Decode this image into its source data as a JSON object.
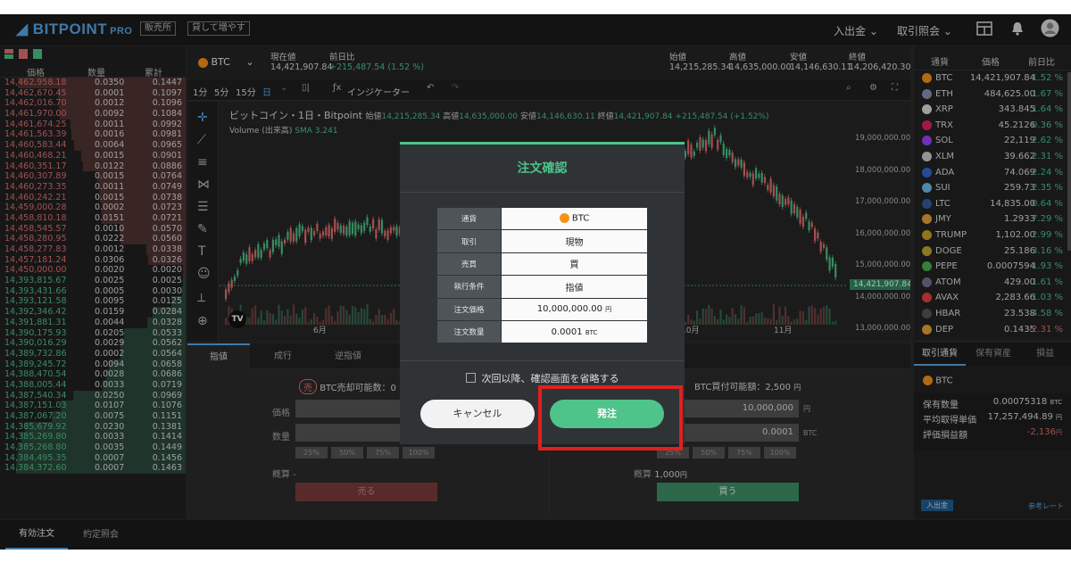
{
  "header": {
    "brand": "BITPOINT",
    "brand_suffix": "PRO",
    "tag1": "販売所",
    "tag2": "貸して増やす",
    "menu1": "入出金",
    "menu2": "取引照会"
  },
  "orderbook": {
    "col_price": "価格",
    "col_qty": "数量",
    "col_total": "累計",
    "asks": [
      [
        "14,462,958.18",
        "0.0350",
        "0.1447"
      ],
      [
        "14,462,670.45",
        "0.0001",
        "0.1097"
      ],
      [
        "14,462,016.70",
        "0.0012",
        "0.1096"
      ],
      [
        "14,461,970.00",
        "0.0092",
        "0.1084"
      ],
      [
        "14,461,674.25",
        "0.0011",
        "0.0992"
      ],
      [
        "14,461,563.39",
        "0.0016",
        "0.0981"
      ],
      [
        "14,460,583.44",
        "0.0064",
        "0.0965"
      ],
      [
        "14,460,468.21",
        "0.0015",
        "0.0901"
      ],
      [
        "14,460,351.17",
        "0.0122",
        "0.0886"
      ],
      [
        "14,460,307.89",
        "0.0015",
        "0.0764"
      ],
      [
        "14,460,273.35",
        "0.0011",
        "0.0749"
      ],
      [
        "14,460,242.21",
        "0.0015",
        "0.0738"
      ],
      [
        "14,459,000.28",
        "0.0002",
        "0.0723"
      ],
      [
        "14,458,810.18",
        "0.0151",
        "0.0721"
      ],
      [
        "14,458,545.57",
        "0.0010",
        "0.0570"
      ],
      [
        "14,458,280.95",
        "0.0222",
        "0.0560"
      ],
      [
        "14,458,277.83",
        "0.0012",
        "0.0338"
      ],
      [
        "14,457,181.24",
        "0.0306",
        "0.0326"
      ],
      [
        "14,450,000.00",
        "0.0020",
        "0.0020"
      ]
    ],
    "bids": [
      [
        "14,393,815.67",
        "0.0025",
        "0.0025"
      ],
      [
        "14,393,431.66",
        "0.0005",
        "0.0030"
      ],
      [
        "14,393,121.58",
        "0.0095",
        "0.0125"
      ],
      [
        "14,392,346.42",
        "0.0159",
        "0.0284"
      ],
      [
        "14,391,881.31",
        "0.0044",
        "0.0328"
      ],
      [
        "14,390,175.93",
        "0.0205",
        "0.0533"
      ],
      [
        "14,390,016.29",
        "0.0029",
        "0.0562"
      ],
      [
        "14,389,732.86",
        "0.0002",
        "0.0564"
      ],
      [
        "14,389,245.72",
        "0.0094",
        "0.0658"
      ],
      [
        "14,388,470.54",
        "0.0028",
        "0.0686"
      ],
      [
        "14,388,005.44",
        "0.0033",
        "0.0719"
      ],
      [
        "14,387,540.34",
        "0.0250",
        "0.0969"
      ],
      [
        "14,387,151.03",
        "0.0107",
        "0.1076"
      ],
      [
        "14,387,067.20",
        "0.0075",
        "0.1151"
      ],
      [
        "14,385,679.92",
        "0.0230",
        "0.1381"
      ],
      [
        "14,385,269.80",
        "0.0033",
        "0.1414"
      ],
      [
        "14,385,268.80",
        "0.0035",
        "0.1449"
      ],
      [
        "14,384,495.35",
        "0.0007",
        "0.1456"
      ],
      [
        "14,384,372.60",
        "0.0007",
        "0.1463"
      ]
    ]
  },
  "ticker": {
    "symbol": "BTC",
    "price_label": "現在値",
    "price": "14,421,907.84",
    "change_label": "前日比",
    "change": "+215,487.54 (1.52 %)",
    "open_label": "始値",
    "open": "14,215,285.34",
    "high_label": "高値",
    "high": "14,635,000.00",
    "low_label": "安値",
    "low": "14,146,630.11",
    "close_label": "終値",
    "close": "14,206,420.30"
  },
  "toolbar": {
    "t1": "1分",
    "t2": "5分",
    "t3": "15分",
    "t4": "日",
    "indicator": "インジケーター"
  },
  "chart": {
    "title": "ビットコイン・1日・Bitpoint",
    "o_label": "始値",
    "o": "14,215,285.34",
    "h_label": "高値",
    "h": "14,635,000.00",
    "l_label": "安値",
    "l": "14,146,630.11",
    "c_label": "終値",
    "c": "14,421,907.84",
    "chg": "+215,487.54 (+1.52%)",
    "volume": "Volume (出来高)",
    "sma": "SMA",
    "sma_val": "3.241",
    "y_ticks": [
      "19,000,000.00",
      "18,000,000.00",
      "17,000,000.00",
      "16,000,000.00",
      "15,000,000.00",
      "14,000,000.00",
      "13,000,000.00"
    ],
    "x_ticks": [
      "6月",
      "10月",
      "11月"
    ],
    "last_price": "14,421,907.84"
  },
  "form": {
    "tabs": [
      "指値",
      "成行",
      "逆指値"
    ],
    "sell_badge": "売",
    "sell_avail": "BTC売却可能数：0",
    "buy_avail": "BTC買付可能額：2,500",
    "buy_avail_unit": "円",
    "price_label": "価格",
    "qty_label": "数量",
    "est_label": "概算",
    "sell_price": "14,450",
    "buy_price": "10,000,000",
    "buy_price_unit": "円",
    "buy_qty": "0.0001",
    "buy_qty_unit": "BTC",
    "pcts": [
      "25%",
      "50%",
      "75%",
      "100%"
    ],
    "sell_est": "-",
    "buy_est": "1,000",
    "buy_est_unit": "円",
    "sell_button": "売る",
    "buy_button": "買う"
  },
  "market": {
    "col_coin": "通貨",
    "col_price": "価格",
    "col_change": "前日比",
    "rows": [
      {
        "sym": "BTC",
        "price": "14,421,907.84",
        "chg": "1.52 %",
        "color": "#f7931a"
      },
      {
        "sym": "ETH",
        "price": "484,625.00",
        "chg": "1.67 %",
        "color": "#8a92b2"
      },
      {
        "sym": "XRP",
        "price": "343.845",
        "chg": "1.64 %",
        "color": "#dddddd"
      },
      {
        "sym": "TRX",
        "price": "45.2126",
        "chg": "0.36 %",
        "color": "#e0245e"
      },
      {
        "sym": "SOL",
        "price": "22,119",
        "chg": "2.62 %",
        "color": "#9945ff"
      },
      {
        "sym": "XLM",
        "price": "39.662",
        "chg": "2.31 %",
        "color": "#cccccc"
      },
      {
        "sym": "ADA",
        "price": "74.069",
        "chg": "2.24 %",
        "color": "#3468d1"
      },
      {
        "sym": "SUI",
        "price": "259.73",
        "chg": "2.35 %",
        "color": "#6fbcf0"
      },
      {
        "sym": "LTC",
        "price": "14,835.00",
        "chg": "0.64 %",
        "color": "#345d9d"
      },
      {
        "sym": "JMY",
        "price": "1.2933",
        "chg": "7.29 %",
        "color": "#e8a33a"
      },
      {
        "sym": "TRUMP",
        "price": "1,102.00",
        "chg": "2.99 %",
        "color": "#c9a227"
      },
      {
        "sym": "DOGE",
        "price": "25.186",
        "chg": "3.16 %",
        "color": "#c2a633"
      },
      {
        "sym": "PEPE",
        "price": "0.0007594",
        "chg": "1.93 %",
        "color": "#4caf50"
      },
      {
        "sym": "ATOM",
        "price": "429.00",
        "chg": "1.61 %",
        "color": "#6f7390"
      },
      {
        "sym": "AVAX",
        "price": "2,283.66",
        "chg": "1.03 %",
        "color": "#e84142"
      },
      {
        "sym": "HBAR",
        "price": "23.538",
        "chg": "4.58 %",
        "color": "#555555"
      },
      {
        "sym": "DEP",
        "price": "0.1435",
        "chg": "-2.31 %",
        "color": "#e8a33a"
      }
    ]
  },
  "balance": {
    "tabs": [
      "取引通貨",
      "保有資産",
      "損益"
    ],
    "coin": "BTC",
    "r1_label": "保有数量",
    "r1": "0.00075318",
    "r1_unit": "BTC",
    "r2_label": "平均取得単価",
    "r2": "17,257,494.89",
    "r2_unit": "円",
    "r3_label": "評価損益額",
    "r3": "-2,136",
    "r3_unit": "円",
    "deposit": "入出金",
    "ref_rate": "参考レート"
  },
  "bottom_tabs": [
    "有効注文",
    "約定照会"
  ],
  "modal": {
    "title": "注文確認",
    "rows": [
      {
        "k": "通貨",
        "v": "BTC"
      },
      {
        "k": "取引",
        "v": "現物"
      },
      {
        "k": "売買",
        "v": "買"
      },
      {
        "k": "執行条件",
        "v": "指値"
      },
      {
        "k": "注文価格",
        "v": "10,000,000.00",
        "unit": "円"
      },
      {
        "k": "注文数量",
        "v": "0.0001",
        "unit": "BTC"
      }
    ],
    "skip_label": "次回以降、確認画面を省略する",
    "cancel": "キャンセル",
    "submit": "発注"
  }
}
